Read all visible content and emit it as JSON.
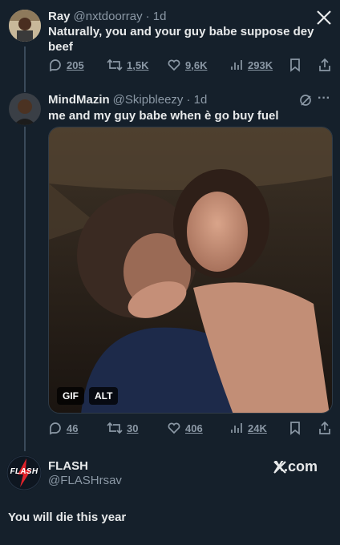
{
  "tweet1": {
    "name": "Ray",
    "handle": "@nxtdoorray",
    "time": "· 1d",
    "text": "Naturally, you and your guy babe suppose dey beef",
    "replies": "205",
    "retweets": "1,5K",
    "likes": "9,6K",
    "views": "293K",
    "brand_icon": "x-logo-icon"
  },
  "tweet2": {
    "name": "MindMazin",
    "handle": "@Skipbleezy",
    "time": "· 1d",
    "text": "me and my guy babe when è go buy fuel",
    "media_badges": [
      "GIF",
      "ALT"
    ],
    "replies": "46",
    "retweets": "30",
    "likes": "406",
    "views": "24K",
    "more": "···"
  },
  "footer": {
    "name": "FLASH",
    "handle": "@FLASHrsav",
    "avatar_text": "FLASH",
    "brand": "X.com",
    "caption": "You will die this year"
  },
  "colors": {
    "background": "#15202b",
    "text": "#e7e9ea",
    "muted": "#8b98a5",
    "flash_red": "#e0232a"
  }
}
